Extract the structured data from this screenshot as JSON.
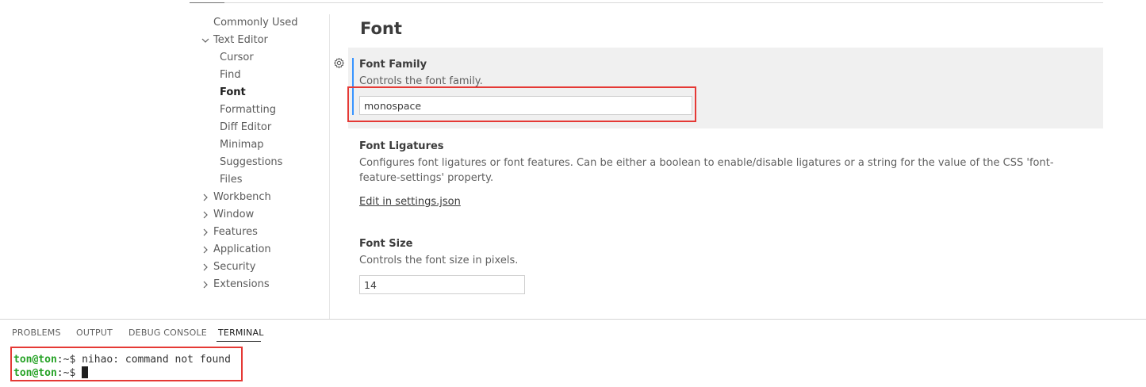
{
  "toc": {
    "items": [
      {
        "label": "Commonly Used",
        "level": 0,
        "expandable": false
      },
      {
        "label": "Text Editor",
        "level": 0,
        "expandable": true,
        "expanded": true
      },
      {
        "label": "Cursor",
        "level": 1
      },
      {
        "label": "Find",
        "level": 1
      },
      {
        "label": "Font",
        "level": 1,
        "active": true
      },
      {
        "label": "Formatting",
        "level": 1
      },
      {
        "label": "Diff Editor",
        "level": 1
      },
      {
        "label": "Minimap",
        "level": 1
      },
      {
        "label": "Suggestions",
        "level": 1
      },
      {
        "label": "Files",
        "level": 1
      },
      {
        "label": "Workbench",
        "level": 0,
        "expandable": true
      },
      {
        "label": "Window",
        "level": 0,
        "expandable": true
      },
      {
        "label": "Features",
        "level": 0,
        "expandable": true
      },
      {
        "label": "Application",
        "level": 0,
        "expandable": true
      },
      {
        "label": "Security",
        "level": 0,
        "expandable": true
      },
      {
        "label": "Extensions",
        "level": 0,
        "expandable": true
      }
    ]
  },
  "section": {
    "title": "Font"
  },
  "settings": {
    "font_family": {
      "label": "Font Family",
      "description": "Controls the font family.",
      "value": "monospace"
    },
    "font_ligatures": {
      "label": "Font Ligatures",
      "description": "Configures font ligatures or font features. Can be either a boolean to enable/disable ligatures or a string for the value of the CSS 'font-feature-settings' property.",
      "link": "Edit in settings.json"
    },
    "font_size": {
      "label": "Font Size",
      "description": "Controls the font size in pixels.",
      "value": "14"
    }
  },
  "panel": {
    "tabs": [
      "PROBLEMS",
      "OUTPUT",
      "DEBUG CONSOLE",
      "TERMINAL"
    ],
    "active_tab": "TERMINAL"
  },
  "terminal": {
    "lines": [
      {
        "user": "ton@ton",
        "path": ":~$ ",
        "text": "nihao: command not found"
      },
      {
        "user": "ton@ton",
        "path": ":~$ ",
        "text": ""
      }
    ]
  },
  "colors": {
    "accent": "#3794ff",
    "annotation_red": "#e53935",
    "prompt_green": "#26a226"
  }
}
